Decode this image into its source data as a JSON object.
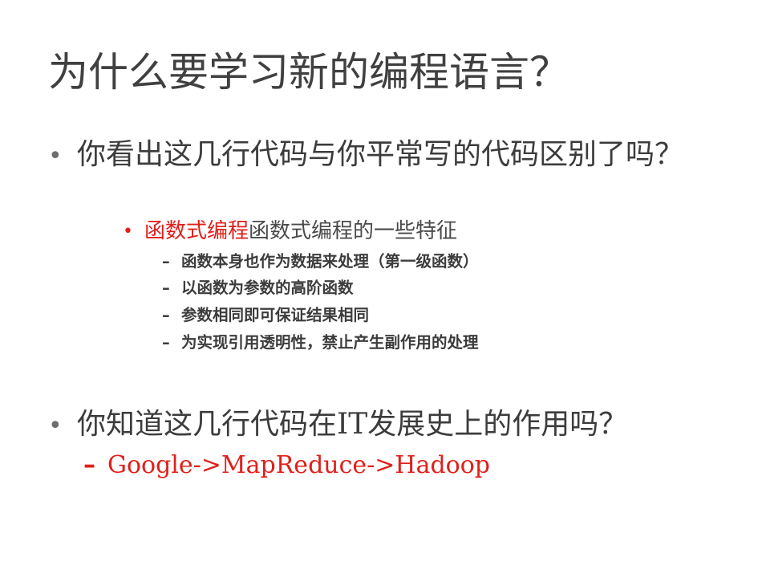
{
  "title": "为什么要学习新的编程语言？",
  "bullet1": {
    "text": "你看出这几行代码与你平常写的代码区别了吗？",
    "sub": {
      "highlight": "函数式编程",
      "rest": "函数式编程的一些特征",
      "items": [
        "函数本身也作为数据来处理（第一级函数）",
        "以函数为参数的高阶函数",
        "参数相同即可保证结果相同",
        "为实现引用透明性，禁止产生副作用的处理"
      ]
    }
  },
  "bullet2": {
    "text": "你知道这几行代码在IT发展史上的作用吗？",
    "sub": "Google->MapReduce->Hadoop"
  },
  "colors": {
    "accent_red": "#e0201b",
    "text_gray": "#3c3c3c"
  }
}
